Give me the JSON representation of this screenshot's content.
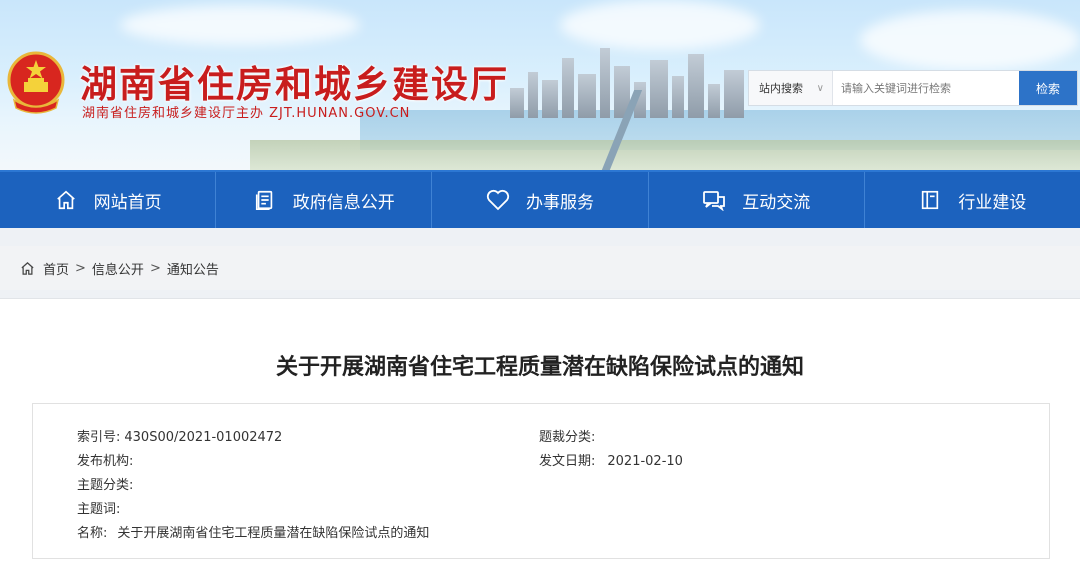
{
  "header": {
    "site_title": "湖南省住房和城乡建设厅",
    "site_subtitle": "湖南省住房和城乡建设厅主办  ZJT.HUNAN.GOV.CN",
    "search_scope": "站内搜索",
    "search_placeholder": "请输入关键词进行检索",
    "search_button": "检索"
  },
  "nav": [
    {
      "label": "网站首页",
      "icon": "home-icon"
    },
    {
      "label": "政府信息公开",
      "icon": "document-icon"
    },
    {
      "label": "办事服务",
      "icon": "heart-icon"
    },
    {
      "label": "互动交流",
      "icon": "chat-icon"
    },
    {
      "label": "行业建设",
      "icon": "book-icon"
    }
  ],
  "breadcrumb": {
    "items": [
      "首页",
      "信息公开",
      "通知公告"
    ],
    "separator": ">"
  },
  "document": {
    "title": "关于开展湖南省住宅工程质量潜在缺陷保险试点的通知",
    "meta": {
      "index_label": "索引号:",
      "index_value": "430S00/2021-01002472",
      "genre_label": "题裁分类:",
      "genre_value": "",
      "publisher_label": "发布机构:",
      "publisher_value": "",
      "date_label": "发文日期:",
      "date_value": "2021-02-10",
      "topic_label": "主题分类:",
      "topic_value": "",
      "keyword_label": "主题词:",
      "keyword_value": "",
      "name_label": "名称:",
      "name_value": "关于开展湖南省住宅工程质量潜在缺陷保险试点的通知"
    }
  },
  "colors": {
    "nav_bg": "#1c62be",
    "title_red": "#c81d1d",
    "search_btn": "#2d73c8"
  }
}
